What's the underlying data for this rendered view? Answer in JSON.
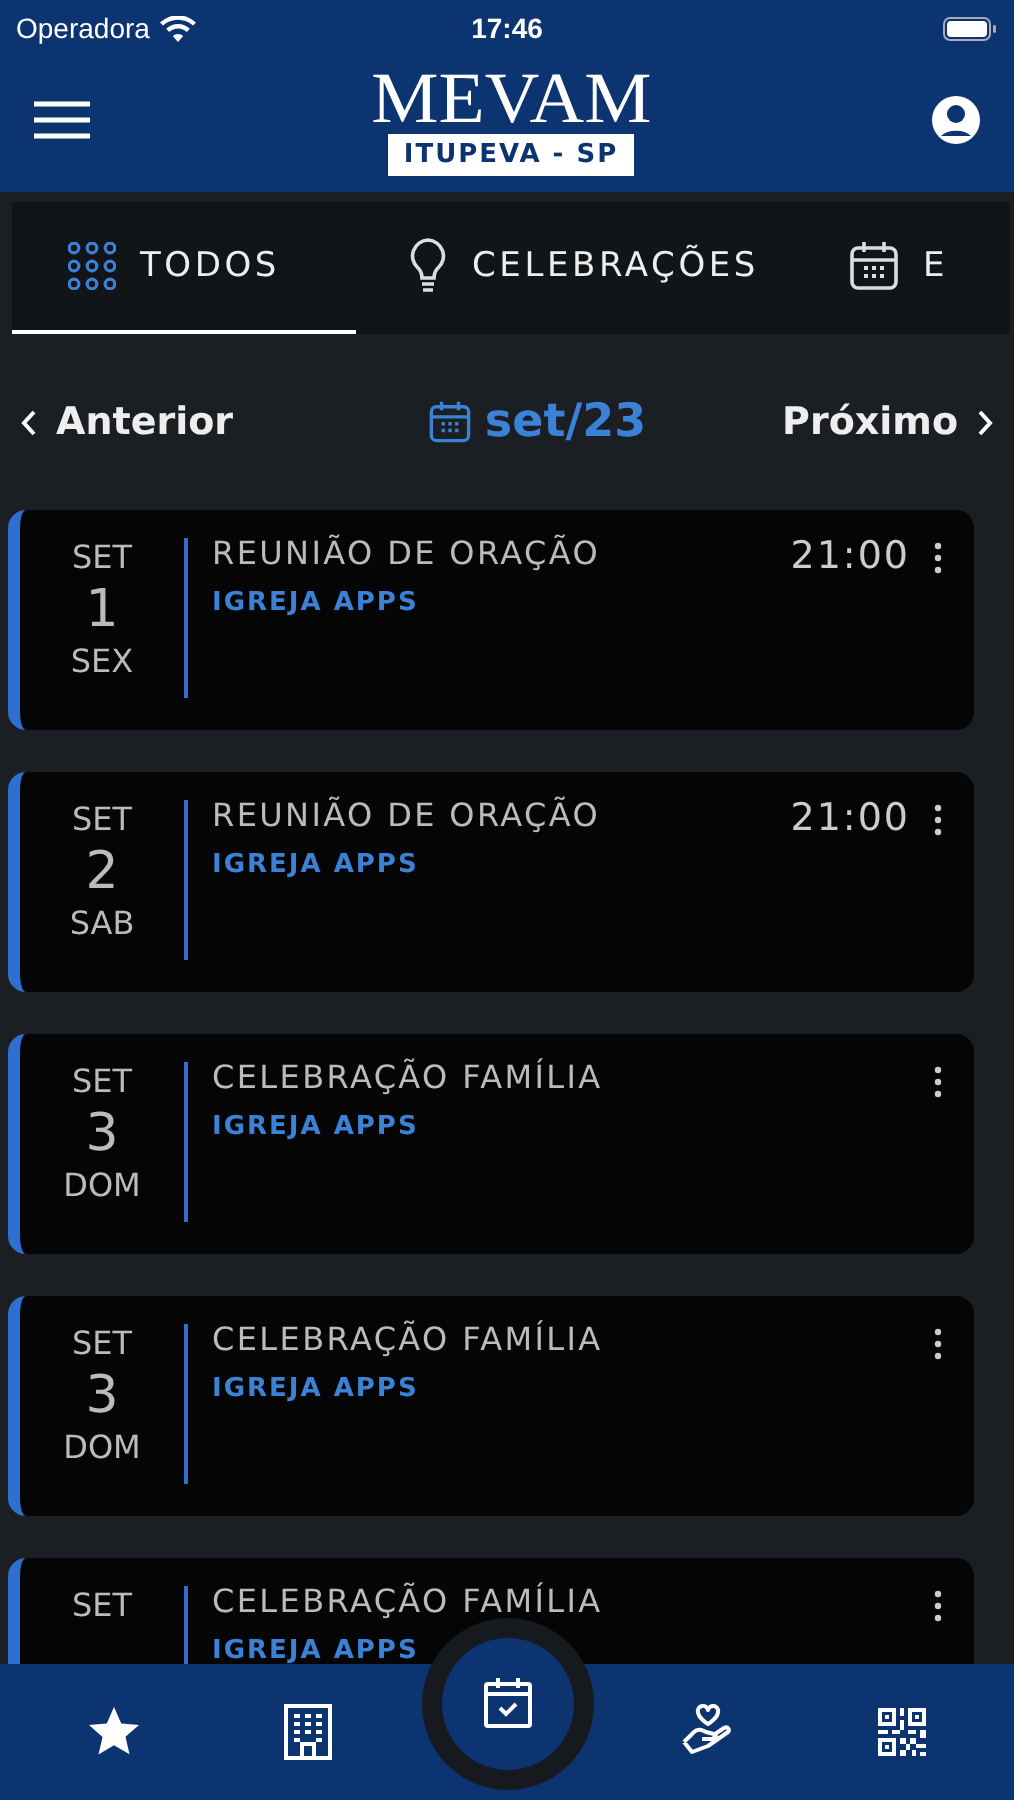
{
  "status_bar": {
    "carrier": "Operadora",
    "time": "17:46"
  },
  "header": {
    "logo_title": "MEVAM",
    "logo_subtitle": "ITUPEVA - SP"
  },
  "tabs": [
    {
      "label": "TODOS",
      "kind": "grid",
      "selected": true
    },
    {
      "label": "CELEBRAÇÕES",
      "kind": "bulb",
      "selected": false
    },
    {
      "label": "E",
      "kind": "calendar",
      "selected": false
    }
  ],
  "month_nav": {
    "previous": "Anterior",
    "month": "set/23",
    "next": "Próximo"
  },
  "events": [
    {
      "month": "SET",
      "day": "1",
      "weekday": "SEX",
      "title": "REUNIÃO DE ORAÇÃO",
      "organizer": "IGREJA APPS",
      "time": "21:00"
    },
    {
      "month": "SET",
      "day": "2",
      "weekday": "SAB",
      "title": "REUNIÃO DE ORAÇÃO",
      "organizer": "IGREJA APPS",
      "time": "21:00"
    },
    {
      "month": "SET",
      "day": "3",
      "weekday": "DOM",
      "title": "CELEBRAÇÃO FAMÍLIA",
      "organizer": "IGREJA APPS"
    },
    {
      "month": "SET",
      "day": "3",
      "weekday": "DOM",
      "title": "CELEBRAÇÃO FAMÍLIA",
      "organizer": "IGREJA APPS"
    },
    {
      "month": "SET",
      "title": "CELEBRAÇÃO FAMÍLIA",
      "organizer": "IGREJA APPS"
    }
  ],
  "bottom_nav": [
    {
      "kind": "star",
      "selected": false
    },
    {
      "kind": "building",
      "selected": false
    },
    {
      "kind": "calendar",
      "selected": true
    },
    {
      "kind": "charity",
      "selected": false
    },
    {
      "kind": "qr",
      "selected": false
    }
  ]
}
